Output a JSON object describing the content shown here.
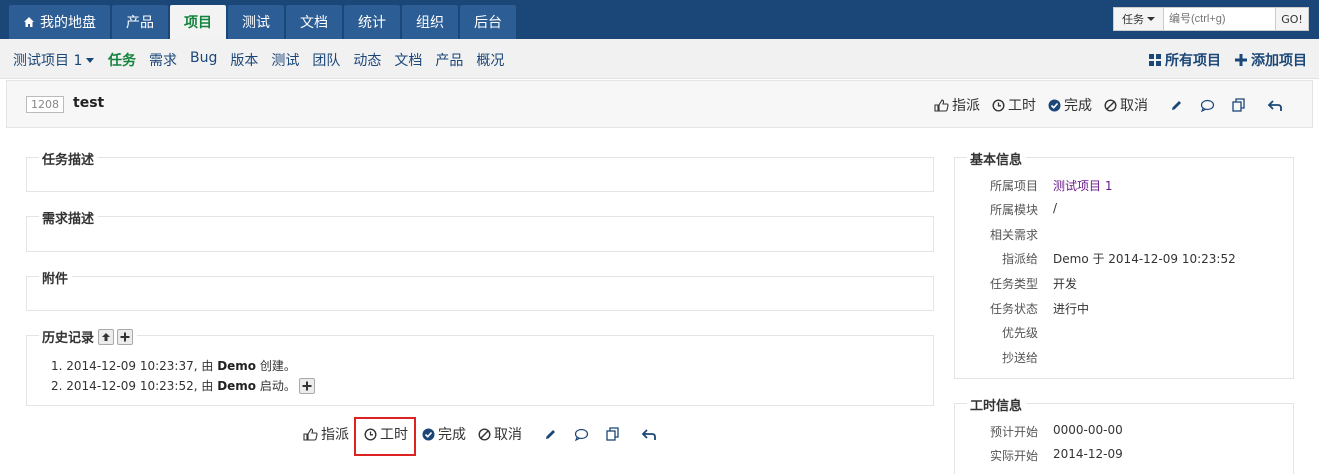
{
  "topnav": {
    "tabs": [
      {
        "label": "我的地盘",
        "icon": "home-icon"
      },
      {
        "label": "产品"
      },
      {
        "label": "项目",
        "active": true
      },
      {
        "label": "测试"
      },
      {
        "label": "文档"
      },
      {
        "label": "统计"
      },
      {
        "label": "组织"
      },
      {
        "label": "后台"
      }
    ],
    "search": {
      "type": "任务",
      "placeholder": "编号(ctrl+g)",
      "go": "GO!"
    }
  },
  "subnav": {
    "project": "测试项目 1",
    "links": [
      "任务",
      "需求",
      "Bug",
      "版本",
      "测试",
      "团队",
      "动态",
      "文档",
      "产品",
      "概况"
    ],
    "active": "任务",
    "right": [
      {
        "label": "所有项目",
        "icon": "grid-icon"
      },
      {
        "label": "添加项目",
        "icon": "plus-icon"
      }
    ]
  },
  "task": {
    "id": "1208",
    "title": "test"
  },
  "actions": {
    "assign": "指派",
    "effort": "工时",
    "finish": "完成",
    "cancel": "取消"
  },
  "sections": {
    "desc": "任务描述",
    "story": "需求描述",
    "files": "附件",
    "history": "历史记录"
  },
  "history": [
    {
      "num": "1.",
      "time": "2014-12-09 10:23:37, 由",
      "user": "Demo",
      "action": "创建。"
    },
    {
      "num": "2.",
      "time": "2014-12-09 10:23:52, 由",
      "user": "Demo",
      "action": "启动。"
    }
  ],
  "basic_info": {
    "title": "基本信息",
    "rows": [
      {
        "k": "所属项目",
        "v": "测试项目 1",
        "link": true
      },
      {
        "k": "所属模块",
        "v": "/"
      },
      {
        "k": "相关需求",
        "v": ""
      },
      {
        "k": "指派给",
        "v": "Demo 于 2014-12-09 10:23:52"
      },
      {
        "k": "任务类型",
        "v": "开发"
      },
      {
        "k": "任务状态",
        "v": "进行中"
      },
      {
        "k": "优先级",
        "v": ""
      },
      {
        "k": "抄送给",
        "v": ""
      }
    ]
  },
  "effort_info": {
    "title": "工时信息",
    "rows": [
      {
        "k": "预计开始",
        "v": "0000-00-00"
      },
      {
        "k": "实际开始",
        "v": "2014-12-09"
      }
    ]
  },
  "colors": {
    "brand": "#1b4678",
    "active_green": "#13833e",
    "highlight": "#dd2222"
  }
}
